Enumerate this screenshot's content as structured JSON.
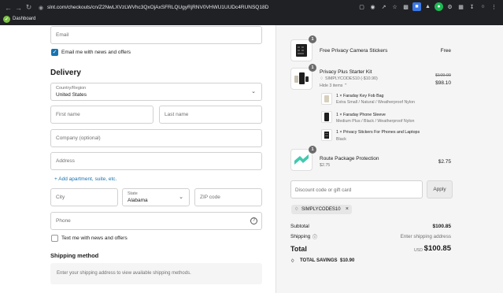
{
  "browser": {
    "url": "slnt.com/checkouts/cn/Z2NwLXVzLWVhc3QxOjAxSFRLQUgyRjRNV0VHWU1UUDc4RUNSQ18D",
    "bookmark_label": "Dashboard",
    "icons": [
      "back-icon",
      "forward-icon",
      "reload-icon",
      "lock-icon"
    ]
  },
  "contact": {
    "email_placeholder": "Email",
    "news_label": "Email me with news and offers",
    "news_checked": true
  },
  "delivery": {
    "heading": "Delivery",
    "country_label": "Country/Region",
    "country_value": "United States",
    "first_name_placeholder": "First name",
    "last_name_placeholder": "Last name",
    "company_placeholder": "Company (optional)",
    "address_placeholder": "Address",
    "add_apartment_link": "+ Add apartment, suite, etc.",
    "city_placeholder": "City",
    "state_label": "State",
    "state_value": "Alabama",
    "zip_placeholder": "ZIP code",
    "phone_placeholder": "Phone",
    "text_news_label": "Text me with news and offers",
    "text_news_checked": false
  },
  "shipping": {
    "heading": "Shipping method",
    "message": "Enter your shipping address to view available shipping methods."
  },
  "order": {
    "items": [
      {
        "qty": "1",
        "name": "Free Privacy Camera Stickers",
        "price": "Free"
      },
      {
        "qty": "1",
        "name": "Privacy Plus Starter Kit",
        "code": "SIMPLYCODES10 (-$10.90)",
        "original_price": "$109.00",
        "price": "$98.10",
        "toggle": "Hide 3 items ⌃"
      },
      {
        "qty": "1",
        "name": "Route Package Protection",
        "sub": "$2.75",
        "price": "$2.75"
      }
    ],
    "sub_items": [
      {
        "name": "1 × Faraday Key Fob Bag",
        "variant": "Extra Small / Natural / Weatherproof Nylon"
      },
      {
        "name": "1 × Faraday Phone Sleeve",
        "variant": "Medium Plus / Black / Weatherproof Nylon"
      },
      {
        "name": "1 × Privacy Stickers For Phones and Laptops",
        "variant": "Black"
      }
    ],
    "discount_placeholder": "Discount code or gift card",
    "apply_label": "Apply",
    "applied_code": "SIMPLYCODES10",
    "subtotal_label": "Subtotal",
    "subtotal_value": "$100.85",
    "shipping_label": "Shipping",
    "shipping_value": "Enter shipping address",
    "total_label": "Total",
    "currency": "USD",
    "total_value": "$100.85",
    "savings_label": "TOTAL SAVINGS",
    "savings_value": "$10.90"
  },
  "colors": {
    "link": "#1773b0",
    "checkbox": "#1773b0",
    "right_bg": "#f5f5f5",
    "chrome_bg": "#202124",
    "route_accent": "#43c9b0"
  }
}
